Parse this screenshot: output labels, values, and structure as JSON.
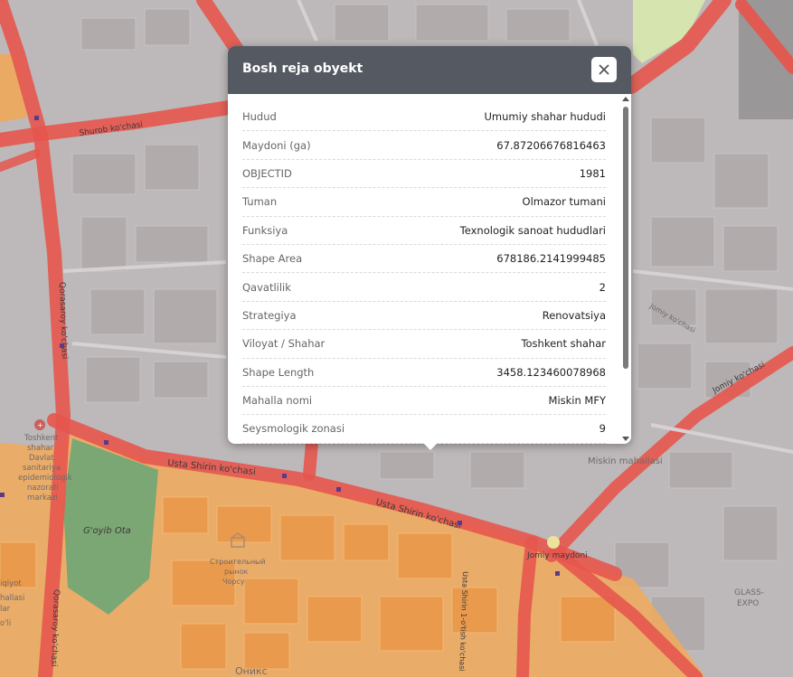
{
  "popup": {
    "title": "Bosh reja obyekt",
    "close_label": "close",
    "rows": [
      {
        "key": "Hudud",
        "value": "Umumiy shahar hududi"
      },
      {
        "key": "Maydoni (ga)",
        "value": "67.87206676816463"
      },
      {
        "key": "OBJECTID",
        "value": "1981"
      },
      {
        "key": "Tuman",
        "value": "Olmazor tumani"
      },
      {
        "key": "Funksiya",
        "value": "Texnologik sanoat hududlari"
      },
      {
        "key": "Shape Area",
        "value": "678186.2141999485"
      },
      {
        "key": "Qavatlilik",
        "value": "2"
      },
      {
        "key": "Strategiya",
        "value": "Renovatsiya"
      },
      {
        "key": "Viloyat / Shahar",
        "value": "Toshkent shahar"
      },
      {
        "key": "Shape Length",
        "value": "3458.123460078968"
      },
      {
        "key": "Mahalla nomi",
        "value": "Miskin MFY"
      },
      {
        "key": "Seysmologik zonasi",
        "value": "9"
      }
    ]
  },
  "map": {
    "labels": {
      "shurob": "Shurob ko'chasi",
      "qorasaroy1": "Qorasaroy ko'chasi",
      "qorasaroy2": "Qorasaroy ko'chasi",
      "usta1": "Usta Shirin ko'chasi",
      "usta2": "Usta Shirin ko'chasi",
      "usta3": "Usta Shirin 1-o'tish ko'chasi",
      "goyib": "G'oyib Ota",
      "miskin": "Miskin mahallasi",
      "jomiy1": "Jomiy maydoni",
      "jomiy2": "Jomiy ko'chasi",
      "glass1": "GLASS-",
      "glass2": "EXPO",
      "stroy1": "Строительный",
      "stroy2": "рынок",
      "stroy3": "Чорсу",
      "oniks": "Оникс",
      "toshkent1": "Toshkent",
      "toshkent2": "shahar",
      "toshkent3": "Davlat",
      "toshkent4": "sanitariya",
      "toshkent5": "epidemiologik",
      "toshkent6": "nazorati",
      "toshkent7": "markazi",
      "left_a": "iqiyot",
      "left_b": "hallasi",
      "left_c": "lar",
      "left_d": "o'li",
      "right_small": "Jomiy ko'chasi"
    },
    "colors": {
      "base": "#bdb8b9",
      "road": "#e8584f",
      "orange": "#f2a95a",
      "green": "#6fa676",
      "block": "#b2acad"
    }
  }
}
